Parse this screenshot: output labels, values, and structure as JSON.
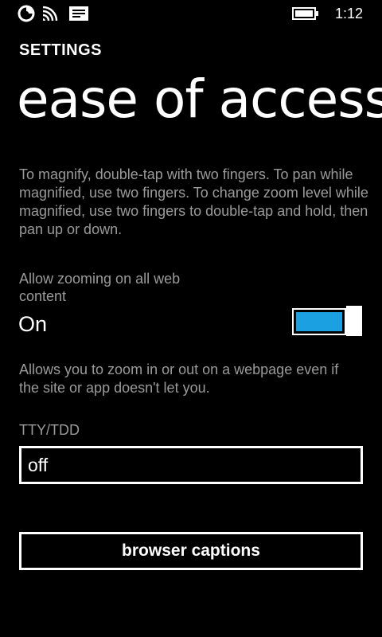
{
  "status_bar": {
    "time": "1:12",
    "icons": [
      "data-sense-icon",
      "wifi-icon",
      "notification-message-icon",
      "battery-icon"
    ]
  },
  "header": {
    "section": "SETTINGS",
    "title": "ease of access"
  },
  "description": "To magnify, double-tap with two fingers. To pan while magnified, use two fingers. To change zoom level while magnified, use two fingers to double-tap and hold, then pan up or down.",
  "zoom_setting": {
    "label": "Allow zooming on all web content",
    "state": "On",
    "enabled": true,
    "help": "Allows you to zoom in or out on a webpage even if the site or app doesn't let you."
  },
  "tty": {
    "label": "TTY/TDD",
    "value": "off"
  },
  "captions_button": {
    "label": "browser captions"
  },
  "colors": {
    "background": "#000000",
    "accent": "#1ba1e2",
    "text": "#ffffff",
    "subtle_text": "#9a9a9a"
  }
}
